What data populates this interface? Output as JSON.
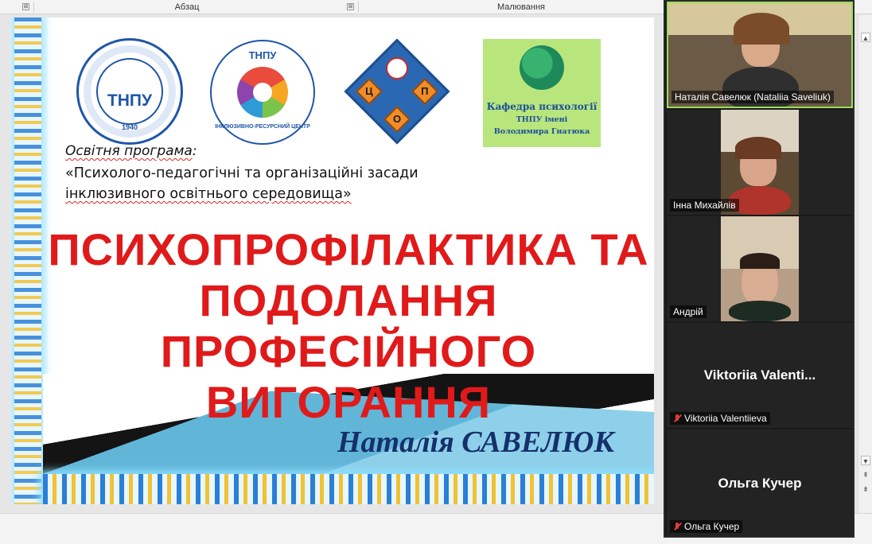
{
  "ribbon": {
    "group_paragraph": "Абзац",
    "group_drawing": "Малювання",
    "launcher_symbol": "⊠"
  },
  "slide": {
    "logos": {
      "tnpu_name": "ТНПУ",
      "tnpu_year": "1940",
      "irc_name": "ТНПУ",
      "irc_subtitle": "ІНКЛЮЗИВНО-РЕСУРСНИЙ ЦЕНТР",
      "cup_letters": [
        "Ц",
        "П",
        "О"
      ],
      "dept_line1": "Кафедра психології",
      "dept_line2": "ТНПУ імені",
      "dept_line3": "Володимира Гнатюка"
    },
    "program_label": "Освітня програма",
    "program_label_colon": ":",
    "program_name_line1": "«Психолого-педагогічні та організаційні засади",
    "program_name_line2": "інклюзивного освітнього середовища»",
    "title_line1": "ПСИХОПРОФІЛАКТИКА ТА",
    "title_line2": "ПОДОЛАННЯ",
    "title_line3": "ПРОФЕСІЙНОГО ВИГОРАННЯ",
    "author": "Наталія САВЕЛЮК"
  },
  "participants": [
    {
      "caption": "Наталія Савелюк (Nataliia Saveliuk)",
      "muted": false,
      "video": true,
      "active": true
    },
    {
      "caption": "Інна Михайлів",
      "muted": false,
      "video": true,
      "active": false
    },
    {
      "caption": "Андрій",
      "muted": false,
      "video": true,
      "active": false
    },
    {
      "caption": "Viktoriia Valentiieva",
      "center_name": "Viktoriia  Valenti...",
      "muted": true,
      "video": false,
      "active": false
    },
    {
      "caption": "Ольга Кучер",
      "center_name": "Ольга Кучер",
      "muted": true,
      "video": false,
      "active": false
    }
  ],
  "colors": {
    "title_red": "#e01a1a",
    "author_navy": "#16306b",
    "active_speaker": "#9adf5b",
    "muted_red": "#e23c3c"
  },
  "scrollbar": {
    "up_arrow": "▲",
    "down_arrow": "▼",
    "page_up": "⇞",
    "page_down": "⇟"
  }
}
